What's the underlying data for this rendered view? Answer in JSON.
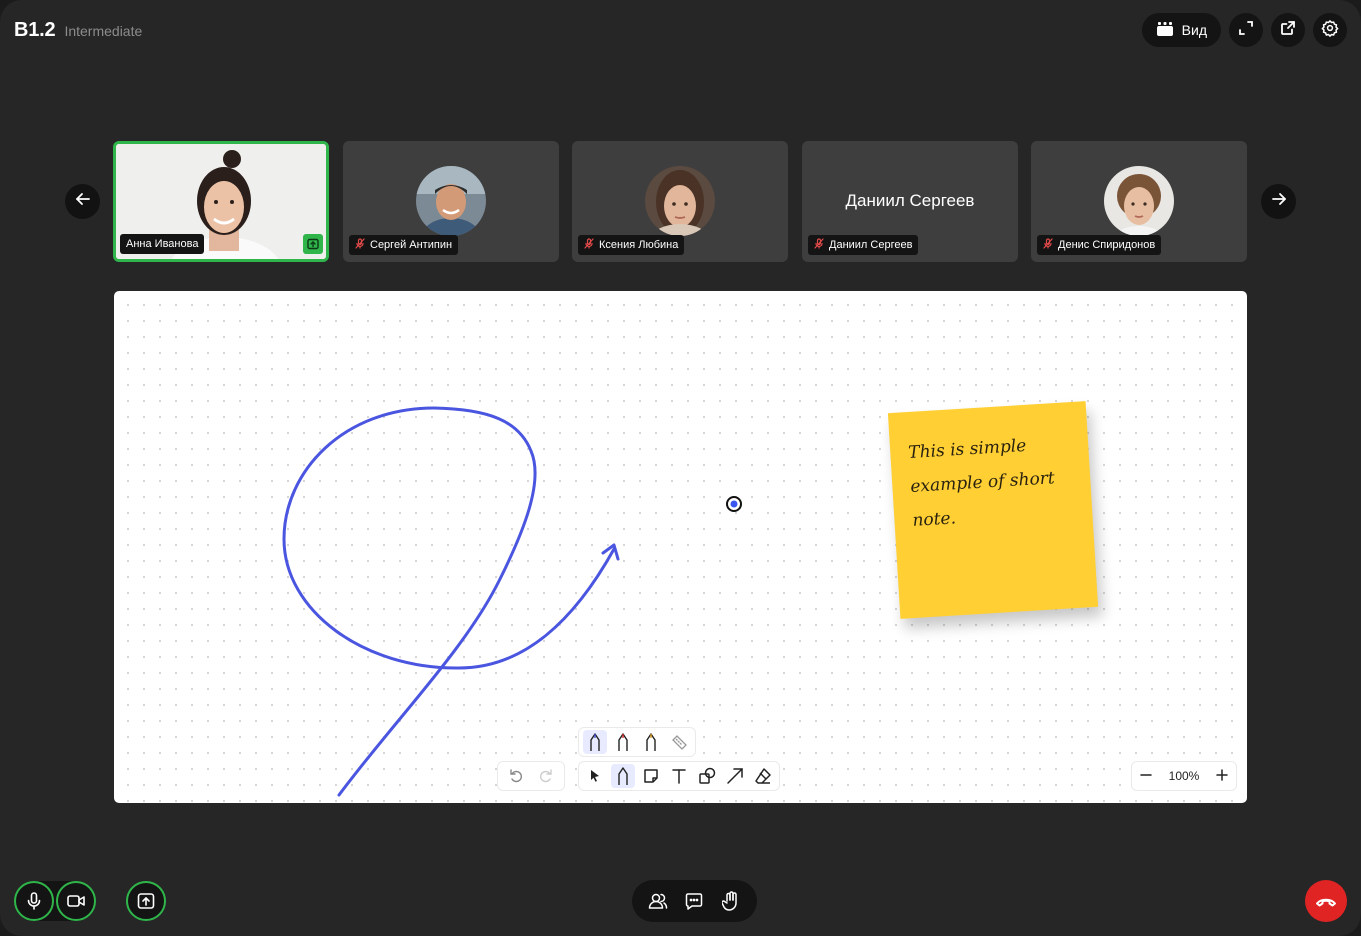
{
  "header": {
    "level": "B1.2",
    "sublevel": "Intermediate",
    "view_label": "Вид"
  },
  "participants": [
    {
      "name": "Анна Иванова",
      "active": true,
      "sharing": true
    },
    {
      "name": "Сергей Антипин",
      "muted": true
    },
    {
      "name": "Ксения Любина",
      "muted": true
    },
    {
      "name": "Даниил Сергеев",
      "muted": true,
      "center_name": "Даниил Сергеев"
    },
    {
      "name": "Денис Спиридонов",
      "muted": true
    }
  ],
  "board": {
    "sticky_note": "This is simple example of short note.",
    "zoom": "100%",
    "stroke_color": "#4a55e0",
    "sticky_color": "#ffcf33"
  },
  "colors": {
    "accent_green": "#2fb54a",
    "hangup_red": "#e02424"
  }
}
